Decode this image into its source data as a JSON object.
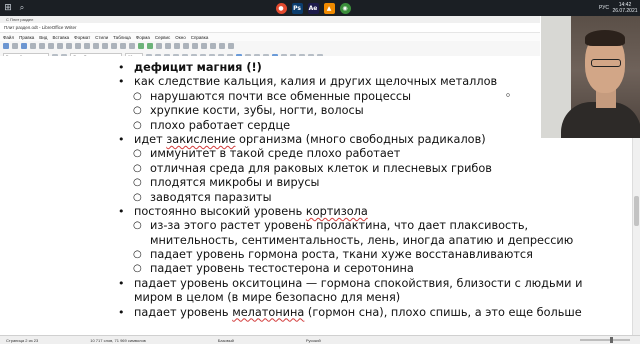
{
  "taskbar": {
    "apps": [
      {
        "icon": "windows-start-icon",
        "color": "#1b1f24"
      },
      {
        "icon": "search-icon",
        "color": "#1b1f24"
      },
      {
        "icon": "app-icon-a",
        "color": "#e34a2f"
      },
      {
        "icon": "photoshop-icon",
        "color": "#0b3d6e",
        "label": "Ps"
      },
      {
        "icon": "after-effects-icon",
        "color": "#1c1a4a",
        "label": "Ae"
      },
      {
        "icon": "vlc-icon",
        "color": "#f08a00"
      },
      {
        "icon": "chrome-icon",
        "color": "#3b8f3b"
      }
    ],
    "clock_time": "14:42",
    "clock_date": "26.07.2021",
    "language": "РУС"
  },
  "window": {
    "doc_tab": "С Плит раздел",
    "title": "Плит раздел.odt - LibreOffice Writer",
    "menu": [
      "Файл",
      "Правка",
      "Вид",
      "Вставка",
      "Формат",
      "Стили",
      "Таблица",
      "Форма",
      "Сервис",
      "Окно",
      "Справка"
    ],
    "paragraph_style": "Базовый",
    "font_name": "Open Sans",
    "font_size": "16"
  },
  "document": {
    "lines": [
      {
        "level": 1,
        "bold": true,
        "text": "дефицит магния (!)"
      },
      {
        "level": 1,
        "text": "как следствие кальция, калия и других щелочных металлов"
      },
      {
        "level": 2,
        "text": "нарушаются почти все обменные процессы"
      },
      {
        "level": 2,
        "text": "хрупкие кости, зубы, ногти, волосы"
      },
      {
        "level": 2,
        "text": "плохо работает сердце"
      },
      {
        "level": 1,
        "pre": "идет ",
        "squiggle": "закисление",
        "post": " организма (много свободных радикалов)"
      },
      {
        "level": 2,
        "text": "иммунитет в такой среде плохо работает"
      },
      {
        "level": 2,
        "text": "отличная среда для раковых клеток и плесневых грибов"
      },
      {
        "level": 2,
        "text": "плодятся микробы и вирусы"
      },
      {
        "level": 2,
        "text": "заводятся паразиты"
      },
      {
        "level": 1,
        "pre": "постоянно высокий уровень ",
        "squiggle": "кортизола",
        "post": ""
      },
      {
        "level": 2,
        "text": "из-за этого растет уровень пролактина, что дает плаксивость,"
      },
      {
        "level": 3,
        "text": "мнительность, сентиментальность, лень, иногда апатию и депрессию"
      },
      {
        "level": 2,
        "text": "падает уровень гормона роста, ткани хуже восстанавливаются"
      },
      {
        "level": 2,
        "text": "падает уровень тестостерона и серотонина"
      },
      {
        "level": 1,
        "text": "падает уровень окситоцина — гормона спокойствия, близости с людьми и"
      },
      {
        "level": 4,
        "text": "миром в целом (в мире безопасно для меня)"
      },
      {
        "level": 1,
        "pre": "падает уровень ",
        "squiggle": "мелатонина",
        "post": " (гормон сна), плохо спишь, а это еще больше"
      }
    ]
  },
  "statusbar": {
    "page": "Страница 2 из 23",
    "words": "10 717 слов, 71 969 символов",
    "style": "Базовый",
    "language": "Русский"
  },
  "colors": {
    "spellcheck_underline": "#d23b3b",
    "taskbar_bg": "#1b1f24"
  }
}
